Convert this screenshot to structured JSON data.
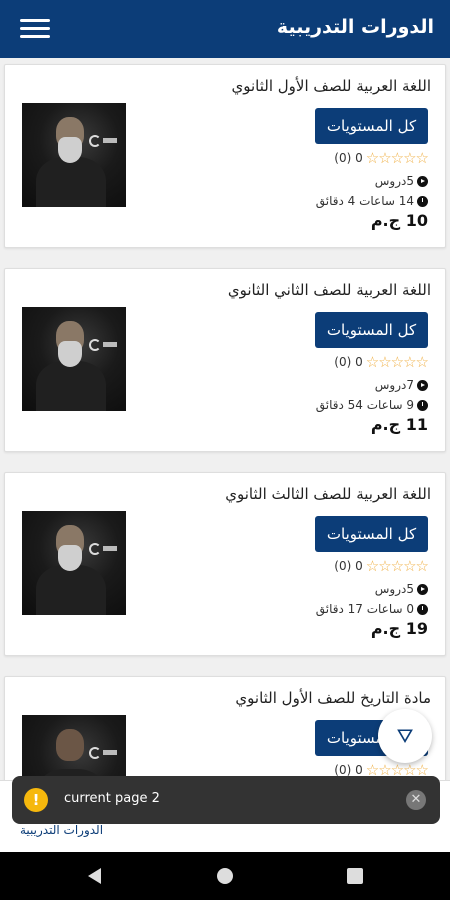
{
  "header": {
    "title": "الدورات التدريبية",
    "menu_icon": "hamburger-icon"
  },
  "courses": [
    {
      "title": "اللغة العربية للصف الأول الثانوي",
      "button": "كل المستويات",
      "stars": "☆☆☆☆☆",
      "rating": "0 (0)",
      "lessons": "5دروس",
      "duration": "14 ساعات 4 دقائق",
      "price": "10 ج.م"
    },
    {
      "title": "اللغة العربية للصف الثاني الثانوي",
      "button": "كل المستويات",
      "stars": "☆☆☆☆☆",
      "rating": "0 (0)",
      "lessons": "7دروس",
      "duration": "9 ساعات 54 دقائق",
      "price": "11 ج.م"
    },
    {
      "title": "اللغة العربية للصف الثالث الثانوي",
      "button": "كل المستويات",
      "stars": "☆☆☆☆☆",
      "rating": "0 (0)",
      "lessons": "5دروس",
      "duration": "0 ساعات 17 دقائق",
      "price": "19 ج.م"
    },
    {
      "title": "مادة التاريخ للصف الأول الثانوي",
      "button": "كل المستويات",
      "stars": "☆☆☆☆☆",
      "rating": "0 (0)"
    }
  ],
  "filter": {
    "icon": "filter-icon",
    "glyph": "⛛"
  },
  "bottom_nav": {
    "active_label": "الدورات التدريبية"
  },
  "snackbar": {
    "icon": "warning-icon",
    "icon_glyph": "!",
    "message": "current page 2",
    "close_glyph": "✕"
  },
  "colors": {
    "primary": "#0c3d78",
    "star": "#f0b24a",
    "warning": "#f6b80d",
    "snackbar": "#333333"
  }
}
